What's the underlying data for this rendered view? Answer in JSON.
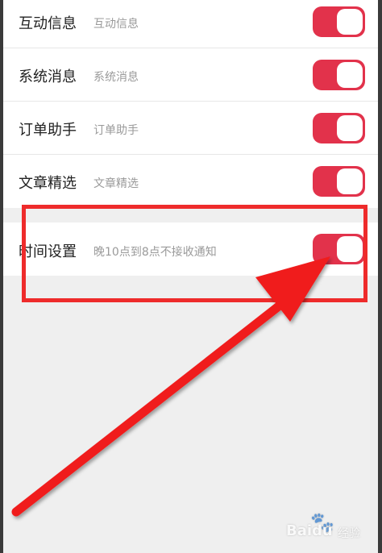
{
  "settings": {
    "rows": [
      {
        "title": "互动信息",
        "desc": "互动信息",
        "enabled": true
      },
      {
        "title": "系统消息",
        "desc": "系统消息",
        "enabled": true
      },
      {
        "title": "订单助手",
        "desc": "订单助手",
        "enabled": true
      },
      {
        "title": "文章精选",
        "desc": "文章精选",
        "enabled": true
      }
    ],
    "night": {
      "title": "时间设置",
      "desc": "晚10点到8点不接收通知",
      "enabled": true
    }
  },
  "colors": {
    "toggle_on": "#e2324b",
    "annotation": "#ee2b2b"
  },
  "icons": {
    "watermark": "baidu-paw-icon"
  },
  "watermark": {
    "brand": "Baidu",
    "sub": "经验"
  }
}
